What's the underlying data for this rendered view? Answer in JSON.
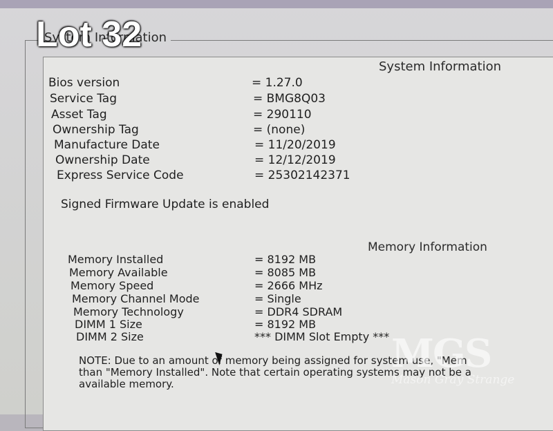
{
  "overlay": {
    "lot_label": "Lot 32",
    "watermark": {
      "logo": "MGS",
      "subtitle": "Mason Gray Strange"
    }
  },
  "frame": {
    "title": "System Information"
  },
  "system_info": {
    "heading": "System Information",
    "rows": [
      {
        "label": "Bios version",
        "value": "= 1.27.0"
      },
      {
        "label": "Service Tag",
        "value": "= BMG8Q03"
      },
      {
        "label": "Asset Tag",
        "value": "= 290110"
      },
      {
        "label": "Ownership Tag",
        "value": "= (none)"
      },
      {
        "label": "Manufacture Date",
        "value": "= 11/20/2019"
      },
      {
        "label": "Ownership Date",
        "value": "= 12/12/2019"
      },
      {
        "label": "Express Service Code",
        "value": "= 25302142371"
      }
    ],
    "firmware_status": "Signed Firmware Update is enabled"
  },
  "memory_info": {
    "heading": "Memory Information",
    "rows": [
      {
        "label": "Memory Installed",
        "value": "= 8192 MB"
      },
      {
        "label": "Memory Available",
        "value": "= 8085 MB"
      },
      {
        "label": "Memory Speed",
        "value": "= 2666 MHz"
      },
      {
        "label": "Memory Channel Mode",
        "value": "= Single"
      },
      {
        "label": "Memory Technology",
        "value": "= DDR4 SDRAM"
      },
      {
        "label": "DIMM 1 Size",
        "value": "= 8192 MB"
      },
      {
        "label": "DIMM 2 Size",
        "value": "*** DIMM Slot Empty ***"
      }
    ],
    "note": "NOTE: Due to an amount of memory being assigned for system use, \"Mem\nthan \"Memory Installed\". Note that certain operating systems may not be a\navailable memory."
  }
}
